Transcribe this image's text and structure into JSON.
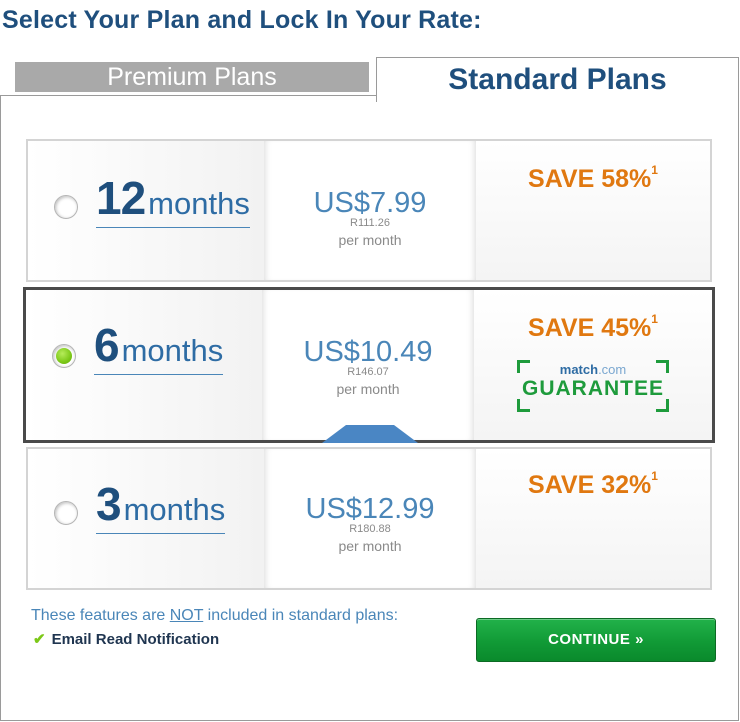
{
  "header": {
    "title": "Select Your Plan and Lock In Your Rate:"
  },
  "tabs": [
    {
      "label": "Premium Plans",
      "active": false
    },
    {
      "label": "Standard Plans",
      "active": true
    }
  ],
  "plans": [
    {
      "duration": "12",
      "unit": "months",
      "price": "US$7.99",
      "local_price": "R111.26",
      "per": "per month",
      "save": "SAVE 58%",
      "footnote": "1",
      "selected": false
    },
    {
      "duration": "6",
      "unit": "months",
      "price": "US$10.49",
      "local_price": "R146.07",
      "per": "per month",
      "save": "SAVE 45%",
      "footnote": "1",
      "selected": true,
      "guarantee": {
        "brand_name": "match",
        "brand_suffix": ".com",
        "label": "GUARANTEE"
      }
    },
    {
      "duration": "3",
      "unit": "months",
      "price": "US$12.99",
      "local_price": "R180.88",
      "per": "per month",
      "save": "SAVE 32%",
      "footnote": "1",
      "selected": false
    }
  ],
  "features": {
    "note_prefix": "These features are ",
    "note_emphasis": "NOT",
    "note_suffix": " included in standard plans:",
    "items": [
      {
        "check": "✔",
        "label": "Email Read Notification"
      }
    ]
  },
  "continue_button": {
    "label": "CONTINUE",
    "chevron": "»"
  },
  "colors": {
    "title_blue": "#1f4f7d",
    "price_blue": "#4a86b8",
    "save_orange": "#e07810",
    "guarantee_green": "#1e9b3c",
    "button_green": "#119a36",
    "radio_green": "#7cc818"
  }
}
